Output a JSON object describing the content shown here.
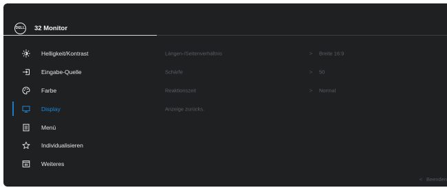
{
  "header": {
    "logo_text": "DELL",
    "title": "32 Monitor"
  },
  "colors": {
    "background": "#1e2022",
    "accent": "#1a7cc8",
    "text": "#e6e6e6",
    "dim_text": "#5c5f63"
  },
  "menu": {
    "items": [
      {
        "label": "Helligkeit/Kontrast",
        "icon": "brightness-icon"
      },
      {
        "label": "Eingabe-Quelle",
        "icon": "input-source-icon"
      },
      {
        "label": "Farbe",
        "icon": "palette-icon"
      },
      {
        "label": "Display",
        "icon": "display-icon",
        "active": true
      },
      {
        "label": "Menü",
        "icon": "menu-icon"
      },
      {
        "label": "Individualisieren",
        "icon": "star-icon"
      },
      {
        "label": "Weiteres",
        "icon": "others-icon"
      }
    ]
  },
  "display_settings": {
    "rows": [
      {
        "label": "Längen-/Seitenverhältnis",
        "chevron": ">",
        "value": "Breite 16:9"
      },
      {
        "label": "Schärfe",
        "chevron": ">",
        "value": "50"
      },
      {
        "label": "Reaktionszeit",
        "chevron": ">",
        "value": "Normal"
      },
      {
        "label": "Anzeige zurücks."
      }
    ]
  },
  "footer": {
    "exit_chevron": "<",
    "exit_label": "Beenden"
  }
}
